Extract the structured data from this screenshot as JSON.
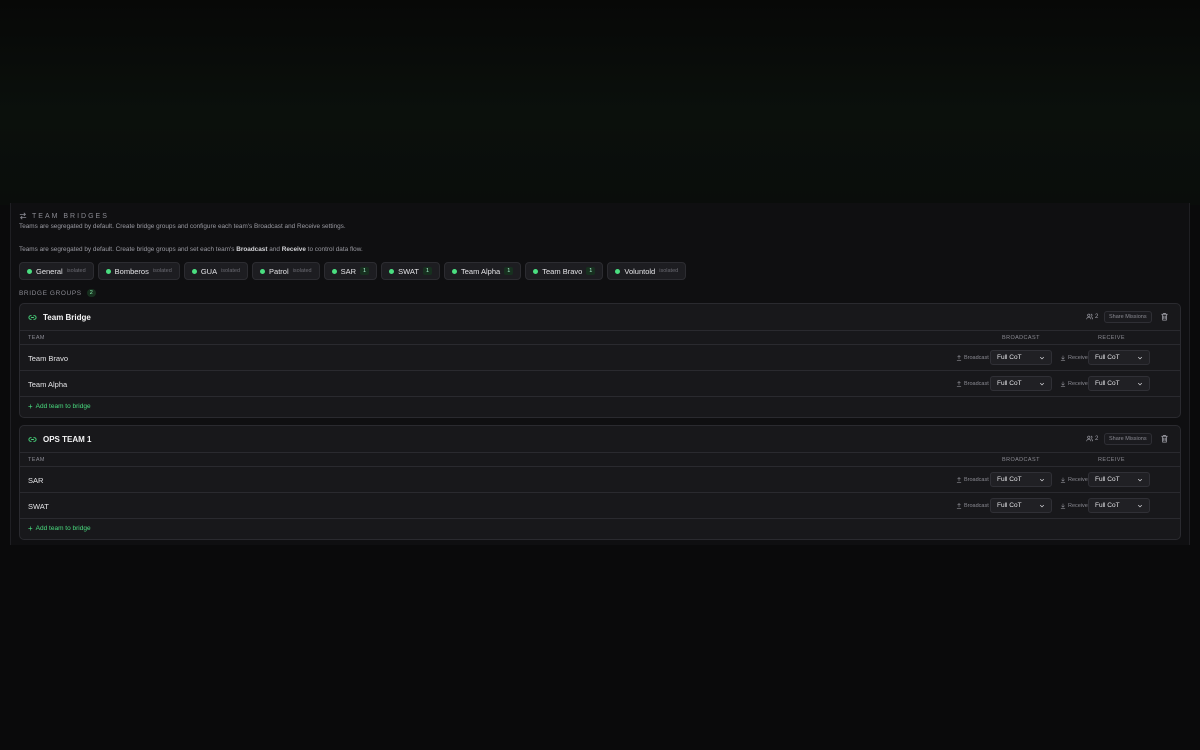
{
  "header": {
    "title": "TEAM BRIDGES",
    "description": "Teams are segregated by default. Create bridge groups and configure each team's Broadcast and Receive settings.",
    "help_prefix": "Teams are segregated by default. Create bridge groups and set each team's",
    "help_broadcast": "Broadcast",
    "help_and": "and",
    "help_receive": "Receive",
    "help_suffix": "to control data flow."
  },
  "teams": [
    {
      "name": "General",
      "badge": "isolated"
    },
    {
      "name": "Bomberos",
      "badge": "isolated"
    },
    {
      "name": "GUA",
      "badge": "isolated"
    },
    {
      "name": "Patrol",
      "badge": "isolated"
    },
    {
      "name": "SAR",
      "count": "1"
    },
    {
      "name": "SWAT",
      "count": "1"
    },
    {
      "name": "Team Alpha",
      "count": "1"
    },
    {
      "name": "Team Bravo",
      "count": "1"
    },
    {
      "name": "Voluntold",
      "badge": "isolated"
    }
  ],
  "bridge_groups": {
    "label": "BRIDGE GROUPS",
    "count": "2",
    "columns": {
      "team": "TEAM",
      "broadcast": "BROADCAST",
      "receive": "RECEIVE"
    },
    "broadcast_label": "Broadcast",
    "receive_label": "Receive",
    "share_label": "Share Missions",
    "add_label": "Add team to bridge",
    "groups": [
      {
        "name": "Team Bridge",
        "members": "2",
        "rows": [
          {
            "team": "Team Bravo",
            "broadcast": "Full CoT",
            "receive": "Full CoT"
          },
          {
            "team": "Team Alpha",
            "broadcast": "Full CoT",
            "receive": "Full CoT"
          }
        ]
      },
      {
        "name": "OPS TEAM 1",
        "members": "2",
        "rows": [
          {
            "team": "SAR",
            "broadcast": "Full CoT",
            "receive": "Full CoT"
          },
          {
            "team": "SWAT",
            "broadcast": "Full CoT",
            "receive": "Full CoT"
          }
        ]
      }
    ]
  },
  "colors": {
    "accent": "#4ade80",
    "background": "#0a0a0b",
    "card": "#18181b"
  }
}
